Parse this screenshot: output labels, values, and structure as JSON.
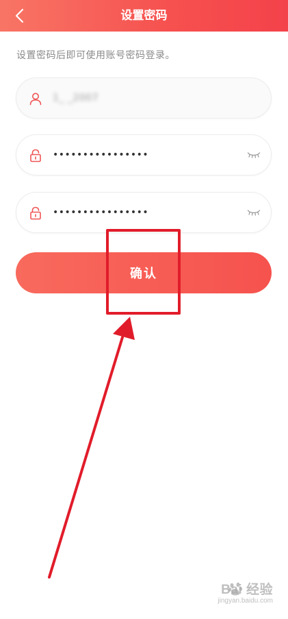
{
  "header": {
    "title": "设置密码",
    "back_icon": "chevron-left-icon"
  },
  "hint": "设置密码后即可使用账号密码登录。",
  "fields": {
    "account": {
      "icon": "user-icon",
      "value": "1_ _2007"
    },
    "password": {
      "icon": "lock-icon",
      "value": "••••••••••••••••",
      "toggle_icon": "eye-closed-icon"
    },
    "confirm_password": {
      "icon": "lock-icon",
      "value": "••••••••••••••••",
      "toggle_icon": "eye-closed-icon"
    }
  },
  "confirm_button": {
    "label": "确认"
  },
  "watermark": {
    "main": "Bai 经验",
    "sub": "jingyan.baidu.com"
  },
  "colors": {
    "header_start": "#f87565",
    "header_end": "#f4424a",
    "button": "#f6524e",
    "icon": "#f05454",
    "annotation": "#e11c2a"
  }
}
